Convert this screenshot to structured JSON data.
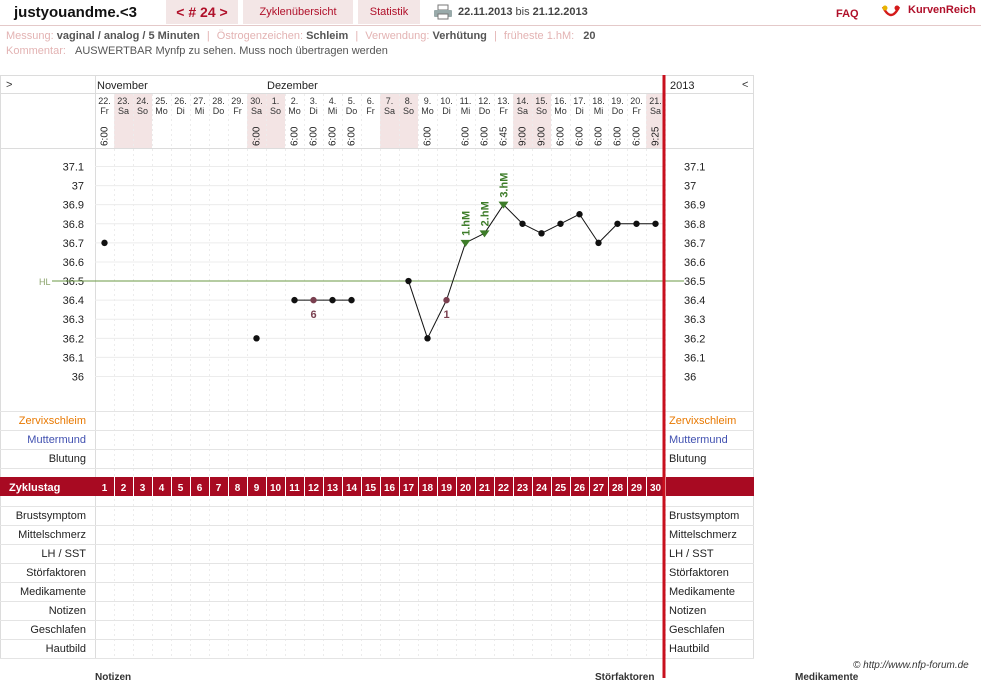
{
  "app": {
    "username": "justyouandme.<3",
    "cycle_nav": "< # 24 >",
    "tabs": [
      "Zyklenübersicht",
      "Statistik"
    ],
    "date_from": "22.11.2013",
    "date_bis": "bis",
    "date_to": "21.12.2013",
    "faq": "FAQ",
    "brand": "KurvenReich"
  },
  "meta": {
    "messung_label": "Messung:",
    "messung_value": "vaginal / analog / 5 Minuten",
    "oestrogen_label": "Östrogenzeichen:",
    "oestrogen_value": "Schleim",
    "verwendung_label": "Verwendung:",
    "verwendung_value": "Verhütung",
    "hm_label": "früheste 1.hM:",
    "hm_value": "20",
    "kommentar_label": "Kommentar:",
    "kommentar_value": "AUSWERTBAR  Mynfp zu sehen. Muss noch übertragen werden"
  },
  "chart_data": {
    "type": "line",
    "year": "2013",
    "nav_left": ">",
    "nav_right": "<",
    "months": [
      {
        "label": "November",
        "day": 1
      },
      {
        "label": "Dezember",
        "day": 10
      }
    ],
    "dates": [
      "22.",
      "23.",
      "24.",
      "25.",
      "26.",
      "27.",
      "28.",
      "29.",
      "30.",
      "1.",
      "2.",
      "3.",
      "4.",
      "5.",
      "6.",
      "7.",
      "8.",
      "9.",
      "10.",
      "11.",
      "12.",
      "13.",
      "14.",
      "15.",
      "16.",
      "17.",
      "18.",
      "19.",
      "20.",
      "21."
    ],
    "weekdays": [
      "Fr",
      "Sa",
      "So",
      "Mo",
      "Di",
      "Mi",
      "Do",
      "Fr",
      "Sa",
      "So",
      "Mo",
      "Di",
      "Mi",
      "Do",
      "Fr",
      "Sa",
      "So",
      "Mo",
      "Di",
      "Mi",
      "Do",
      "Fr",
      "Sa",
      "So",
      "Mo",
      "Di",
      "Mi",
      "Do",
      "Fr",
      "Sa"
    ],
    "times": [
      "6:00",
      "",
      "",
      "",
      "",
      "",
      "",
      "",
      "6:00",
      "",
      "6:00",
      "6:00",
      "6:00",
      "6:00",
      "",
      "",
      "",
      "6:00",
      "",
      "6:00",
      "6:00",
      "6:45",
      "9:00",
      "9:00",
      "6:00",
      "6:00",
      "6:00",
      "6:00",
      "6:00",
      "9:25"
    ],
    "shaded_days": [
      2,
      3,
      9,
      10,
      16,
      17,
      23,
      24,
      30
    ],
    "x": [
      1,
      2,
      3,
      4,
      5,
      6,
      7,
      8,
      9,
      10,
      11,
      12,
      13,
      14,
      15,
      16,
      17,
      18,
      19,
      20,
      21,
      22,
      23,
      24,
      25,
      26,
      27,
      28,
      29,
      30
    ],
    "temps": [
      36.7,
      null,
      null,
      null,
      null,
      null,
      null,
      null,
      36.2,
      null,
      36.4,
      36.4,
      36.4,
      36.4,
      null,
      null,
      36.5,
      36.2,
      36.4,
      36.7,
      36.75,
      36.9,
      36.8,
      36.75,
      36.8,
      36.85,
      36.7,
      36.8,
      36.8,
      36.8
    ],
    "excluded_points": [
      {
        "day": 12,
        "label": "6"
      },
      {
        "day": 19,
        "label": "1"
      }
    ],
    "hm_markers": [
      {
        "day": 20,
        "label": "1.hM"
      },
      {
        "day": 21,
        "label": "2.hM"
      },
      {
        "day": 22,
        "label": "3.hM"
      }
    ],
    "coverline": {
      "value": 36.5,
      "label": "HL"
    },
    "y_ticks": [
      "37.1",
      "37",
      "36.9",
      "36.8",
      "36.7",
      "36.6",
      "36.5",
      "36.4",
      "36.3",
      "36.2",
      "36.1",
      "36"
    ],
    "ylim": [
      36.0,
      37.1
    ],
    "rows_top": [
      "Zervixschleim",
      "Muttermund",
      "Blutung"
    ],
    "row_colors": {
      "Zervixschleim": "#e87800",
      "Muttermund": "#4050b0",
      "Blutung": "#222222"
    },
    "zyklustag_label": "Zyklustag",
    "zyklustag": [
      "1",
      "2",
      "3",
      "4",
      "5",
      "6",
      "7",
      "8",
      "9",
      "10",
      "11",
      "12",
      "13",
      "14",
      "15",
      "16",
      "17",
      "18",
      "19",
      "20",
      "21",
      "22",
      "23",
      "24",
      "25",
      "26",
      "27",
      "28",
      "29",
      "30"
    ],
    "rows_bottom": [
      "Brustsymptom",
      "Mittelschmerz",
      "LH / SST",
      "Störfaktoren",
      "Medikamente",
      "Notizen",
      "Geschlafen",
      "Hautbild"
    ],
    "accent_color": "#a80a22",
    "hm_color": "#3e7d2a",
    "excluded_color": "#7a4050"
  },
  "footer": {
    "credit": "© http://www.nfp-forum.de",
    "cut_labels": [
      "Notizen",
      "Störfaktoren",
      "Medikamente"
    ]
  }
}
